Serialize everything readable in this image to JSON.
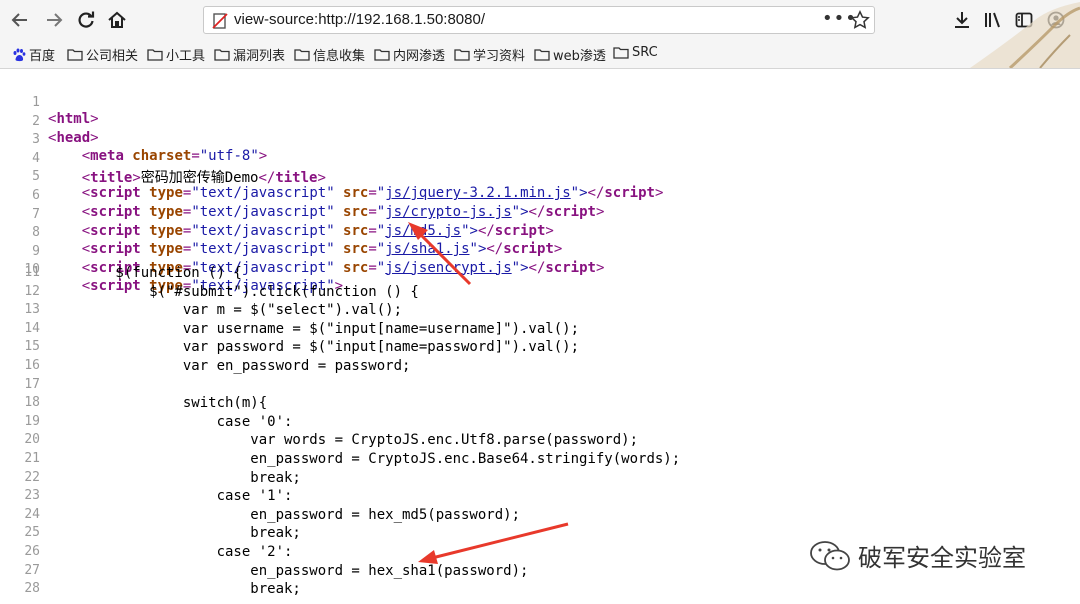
{
  "toolbar": {
    "back_icon": "arrow-left-icon",
    "forward_icon": "arrow-right-icon",
    "reload_icon": "reload-icon",
    "home_icon": "home-icon",
    "url": "view-source:http://192.168.1.50:8080/",
    "page_actions": "•••",
    "bookmark_icon": "star-icon",
    "download_icon": "download-icon",
    "library_icon": "library-icon",
    "sidebar_icon": "sidebar-icon",
    "account_icon": "account-icon"
  },
  "bookmarks": [
    {
      "label": "百度",
      "icon": "baidu-paw-icon"
    },
    {
      "label": "公司相关",
      "icon": "folder-icon"
    },
    {
      "label": "小工具",
      "icon": "folder-icon"
    },
    {
      "label": "漏洞列表",
      "icon": "folder-icon"
    },
    {
      "label": "信息收集",
      "icon": "folder-icon"
    },
    {
      "label": "内网渗透",
      "icon": "folder-icon"
    },
    {
      "label": "学习资料",
      "icon": "folder-icon"
    },
    {
      "label": "web渗透",
      "icon": "folder-icon"
    },
    {
      "label": "SRC",
      "icon": "folder-icon"
    }
  ],
  "source": {
    "line_numbers": [
      "1",
      "2",
      "3",
      "4",
      "5",
      "6",
      "7",
      "8",
      "9",
      "10",
      "11",
      "12",
      "13",
      "14",
      "15",
      "16",
      "17",
      "18",
      "19",
      "20",
      "21",
      "22",
      "23",
      "24",
      "25",
      "26",
      "27",
      "28"
    ],
    "l1": {
      "open": "<",
      "tag": "html",
      "close": ">"
    },
    "l2": {
      "open": "<",
      "tag": "head",
      "close": ">"
    },
    "l3": {
      "indent": "    ",
      "open": "<",
      "tag": "meta",
      "attr": " charset",
      "eq": "=",
      "value": "\"utf-8\"",
      "close": ">"
    },
    "l4": {
      "indent": "    ",
      "open": "<",
      "tag": "title",
      "close": ">",
      "text": "密码加密传输Demo",
      "end_open": "</",
      "end_tag": "title",
      "end_close": ">"
    },
    "scripts": [
      {
        "src": "js/jquery-3.2.1.min.js"
      },
      {
        "src": "js/crypto-js.js"
      },
      {
        "src": "js/md5.js"
      },
      {
        "src": "js/sha1.js"
      },
      {
        "src": "js/jsencrypt.js"
      }
    ],
    "script_parts": {
      "indent": "    ",
      "open": "<",
      "tag": "script",
      "type_attr": " type",
      "eq": "=",
      "type_val": "\"text/javascript\"",
      "src_attr": " src",
      "q": "\"",
      "mid": "\">",
      "end": "</",
      "end_tag": "script",
      "end_close": ">"
    },
    "l10": {
      "indent": "    ",
      "open": "<",
      "tag": "script",
      "type_attr": " type",
      "eq": "=",
      "type_val": "\"text/javascript\"",
      "close": ">"
    },
    "js_lines": [
      "        $(function () {",
      "            $(\"#submit\").click(function () {",
      "                var m = $(\"select\").val();",
      "                var username = $(\"input[name=username]\").val();",
      "                var password = $(\"input[name=password]\").val();",
      "                var en_password = password;",
      "",
      "                switch(m){",
      "                    case '0':",
      "                        var words = CryptoJS.enc.Utf8.parse(password);",
      "                        en_password = CryptoJS.enc.Base64.stringify(words);",
      "                        break;",
      "                    case '1':",
      "                        en_password = hex_md5(password);",
      "                        break;",
      "                    case '2':",
      "                        en_password = hex_sha1(password);",
      "                        break;"
    ]
  },
  "watermark": {
    "text": "破军安全实验室",
    "icon": "wechat-icon"
  },
  "colors": {
    "tag": "#881280",
    "attr": "#994500",
    "value": "#1a1aa6",
    "arrow": "#e8392b"
  }
}
